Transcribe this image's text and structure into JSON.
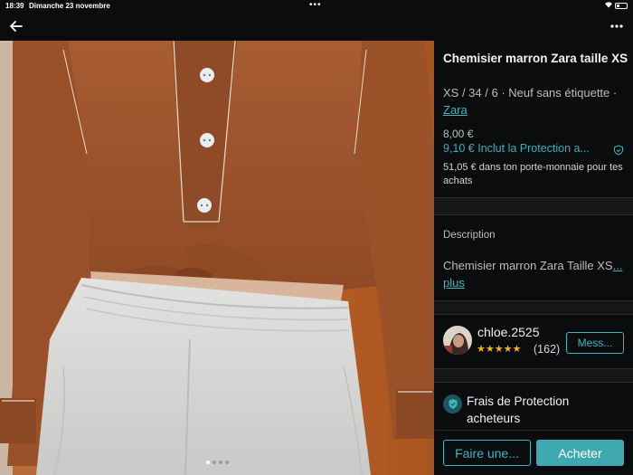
{
  "status_bar": {
    "time": "18:39",
    "date": "Dimanche 23 novembre"
  },
  "colors": {
    "accent": "#3fb5c0",
    "background": "#0b0c0d",
    "stars": "#f5b21e",
    "shirt": "#a4552a"
  },
  "icons": {
    "back": "arrow-left-icon",
    "more": "more-dots-icon",
    "heart": "heart-icon",
    "shield": "shield-icon"
  },
  "photo": {
    "likes": "1",
    "page_count": 4,
    "current_page": 1
  },
  "listing": {
    "title": "Chemisier marron Zara taille XS",
    "details": "XS / 34 / 6 · Neuf sans étiquette · ",
    "brand": "Zara",
    "price": "8,00 €",
    "price_with_protection": "9,10 € Inclut la Protection a...",
    "wallet_info": "51,05 € dans ton porte-monnaie pour tes achats"
  },
  "description": {
    "label": "Description",
    "text": "Chemisier marron Zara Taille XS",
    "more": "... plus"
  },
  "seller": {
    "username": "chloe.2525",
    "stars": "★★★★★",
    "rating": 5,
    "review_count": "(162)",
    "message_button": "Mess..."
  },
  "protection": {
    "title": "Frais de Protection acheteurs"
  },
  "actions": {
    "offer_button": "Faire une...",
    "buy_button": "Acheter"
  }
}
